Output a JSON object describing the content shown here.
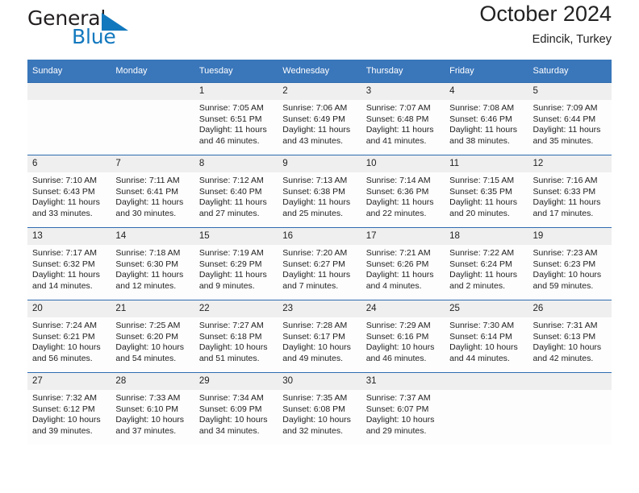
{
  "brand": {
    "name_top": "General",
    "name_bottom": "Blue",
    "accent_color": "#1278be",
    "triangle_icon": "triangle-icon"
  },
  "header": {
    "title": "October 2024",
    "subtitle": "Edincik, Turkey",
    "header_bg": "#3a76ba",
    "daynum_bg": "#efefef"
  },
  "calendar": {
    "weekday_headers": [
      "Sunday",
      "Monday",
      "Tuesday",
      "Wednesday",
      "Thursday",
      "Friday",
      "Saturday"
    ],
    "weeks": [
      [
        {
          "day": "",
          "sunrise": "",
          "sunset": "",
          "daylight_l1": "",
          "daylight_l2": ""
        },
        {
          "day": "",
          "sunrise": "",
          "sunset": "",
          "daylight_l1": "",
          "daylight_l2": ""
        },
        {
          "day": "1",
          "sunrise": "Sunrise: 7:05 AM",
          "sunset": "Sunset: 6:51 PM",
          "daylight_l1": "Daylight: 11 hours",
          "daylight_l2": "and 46 minutes."
        },
        {
          "day": "2",
          "sunrise": "Sunrise: 7:06 AM",
          "sunset": "Sunset: 6:49 PM",
          "daylight_l1": "Daylight: 11 hours",
          "daylight_l2": "and 43 minutes."
        },
        {
          "day": "3",
          "sunrise": "Sunrise: 7:07 AM",
          "sunset": "Sunset: 6:48 PM",
          "daylight_l1": "Daylight: 11 hours",
          "daylight_l2": "and 41 minutes."
        },
        {
          "day": "4",
          "sunrise": "Sunrise: 7:08 AM",
          "sunset": "Sunset: 6:46 PM",
          "daylight_l1": "Daylight: 11 hours",
          "daylight_l2": "and 38 minutes."
        },
        {
          "day": "5",
          "sunrise": "Sunrise: 7:09 AM",
          "sunset": "Sunset: 6:44 PM",
          "daylight_l1": "Daylight: 11 hours",
          "daylight_l2": "and 35 minutes."
        }
      ],
      [
        {
          "day": "6",
          "sunrise": "Sunrise: 7:10 AM",
          "sunset": "Sunset: 6:43 PM",
          "daylight_l1": "Daylight: 11 hours",
          "daylight_l2": "and 33 minutes."
        },
        {
          "day": "7",
          "sunrise": "Sunrise: 7:11 AM",
          "sunset": "Sunset: 6:41 PM",
          "daylight_l1": "Daylight: 11 hours",
          "daylight_l2": "and 30 minutes."
        },
        {
          "day": "8",
          "sunrise": "Sunrise: 7:12 AM",
          "sunset": "Sunset: 6:40 PM",
          "daylight_l1": "Daylight: 11 hours",
          "daylight_l2": "and 27 minutes."
        },
        {
          "day": "9",
          "sunrise": "Sunrise: 7:13 AM",
          "sunset": "Sunset: 6:38 PM",
          "daylight_l1": "Daylight: 11 hours",
          "daylight_l2": "and 25 minutes."
        },
        {
          "day": "10",
          "sunrise": "Sunrise: 7:14 AM",
          "sunset": "Sunset: 6:36 PM",
          "daylight_l1": "Daylight: 11 hours",
          "daylight_l2": "and 22 minutes."
        },
        {
          "day": "11",
          "sunrise": "Sunrise: 7:15 AM",
          "sunset": "Sunset: 6:35 PM",
          "daylight_l1": "Daylight: 11 hours",
          "daylight_l2": "and 20 minutes."
        },
        {
          "day": "12",
          "sunrise": "Sunrise: 7:16 AM",
          "sunset": "Sunset: 6:33 PM",
          "daylight_l1": "Daylight: 11 hours",
          "daylight_l2": "and 17 minutes."
        }
      ],
      [
        {
          "day": "13",
          "sunrise": "Sunrise: 7:17 AM",
          "sunset": "Sunset: 6:32 PM",
          "daylight_l1": "Daylight: 11 hours",
          "daylight_l2": "and 14 minutes."
        },
        {
          "day": "14",
          "sunrise": "Sunrise: 7:18 AM",
          "sunset": "Sunset: 6:30 PM",
          "daylight_l1": "Daylight: 11 hours",
          "daylight_l2": "and 12 minutes."
        },
        {
          "day": "15",
          "sunrise": "Sunrise: 7:19 AM",
          "sunset": "Sunset: 6:29 PM",
          "daylight_l1": "Daylight: 11 hours",
          "daylight_l2": "and 9 minutes."
        },
        {
          "day": "16",
          "sunrise": "Sunrise: 7:20 AM",
          "sunset": "Sunset: 6:27 PM",
          "daylight_l1": "Daylight: 11 hours",
          "daylight_l2": "and 7 minutes."
        },
        {
          "day": "17",
          "sunrise": "Sunrise: 7:21 AM",
          "sunset": "Sunset: 6:26 PM",
          "daylight_l1": "Daylight: 11 hours",
          "daylight_l2": "and 4 minutes."
        },
        {
          "day": "18",
          "sunrise": "Sunrise: 7:22 AM",
          "sunset": "Sunset: 6:24 PM",
          "daylight_l1": "Daylight: 11 hours",
          "daylight_l2": "and 2 minutes."
        },
        {
          "day": "19",
          "sunrise": "Sunrise: 7:23 AM",
          "sunset": "Sunset: 6:23 PM",
          "daylight_l1": "Daylight: 10 hours",
          "daylight_l2": "and 59 minutes."
        }
      ],
      [
        {
          "day": "20",
          "sunrise": "Sunrise: 7:24 AM",
          "sunset": "Sunset: 6:21 PM",
          "daylight_l1": "Daylight: 10 hours",
          "daylight_l2": "and 56 minutes."
        },
        {
          "day": "21",
          "sunrise": "Sunrise: 7:25 AM",
          "sunset": "Sunset: 6:20 PM",
          "daylight_l1": "Daylight: 10 hours",
          "daylight_l2": "and 54 minutes."
        },
        {
          "day": "22",
          "sunrise": "Sunrise: 7:27 AM",
          "sunset": "Sunset: 6:18 PM",
          "daylight_l1": "Daylight: 10 hours",
          "daylight_l2": "and 51 minutes."
        },
        {
          "day": "23",
          "sunrise": "Sunrise: 7:28 AM",
          "sunset": "Sunset: 6:17 PM",
          "daylight_l1": "Daylight: 10 hours",
          "daylight_l2": "and 49 minutes."
        },
        {
          "day": "24",
          "sunrise": "Sunrise: 7:29 AM",
          "sunset": "Sunset: 6:16 PM",
          "daylight_l1": "Daylight: 10 hours",
          "daylight_l2": "and 46 minutes."
        },
        {
          "day": "25",
          "sunrise": "Sunrise: 7:30 AM",
          "sunset": "Sunset: 6:14 PM",
          "daylight_l1": "Daylight: 10 hours",
          "daylight_l2": "and 44 minutes."
        },
        {
          "day": "26",
          "sunrise": "Sunrise: 7:31 AM",
          "sunset": "Sunset: 6:13 PM",
          "daylight_l1": "Daylight: 10 hours",
          "daylight_l2": "and 42 minutes."
        }
      ],
      [
        {
          "day": "27",
          "sunrise": "Sunrise: 7:32 AM",
          "sunset": "Sunset: 6:12 PM",
          "daylight_l1": "Daylight: 10 hours",
          "daylight_l2": "and 39 minutes."
        },
        {
          "day": "28",
          "sunrise": "Sunrise: 7:33 AM",
          "sunset": "Sunset: 6:10 PM",
          "daylight_l1": "Daylight: 10 hours",
          "daylight_l2": "and 37 minutes."
        },
        {
          "day": "29",
          "sunrise": "Sunrise: 7:34 AM",
          "sunset": "Sunset: 6:09 PM",
          "daylight_l1": "Daylight: 10 hours",
          "daylight_l2": "and 34 minutes."
        },
        {
          "day": "30",
          "sunrise": "Sunrise: 7:35 AM",
          "sunset": "Sunset: 6:08 PM",
          "daylight_l1": "Daylight: 10 hours",
          "daylight_l2": "and 32 minutes."
        },
        {
          "day": "31",
          "sunrise": "Sunrise: 7:37 AM",
          "sunset": "Sunset: 6:07 PM",
          "daylight_l1": "Daylight: 10 hours",
          "daylight_l2": "and 29 minutes."
        },
        {
          "day": "",
          "sunrise": "",
          "sunset": "",
          "daylight_l1": "",
          "daylight_l2": ""
        },
        {
          "day": "",
          "sunrise": "",
          "sunset": "",
          "daylight_l1": "",
          "daylight_l2": ""
        }
      ]
    ]
  }
}
